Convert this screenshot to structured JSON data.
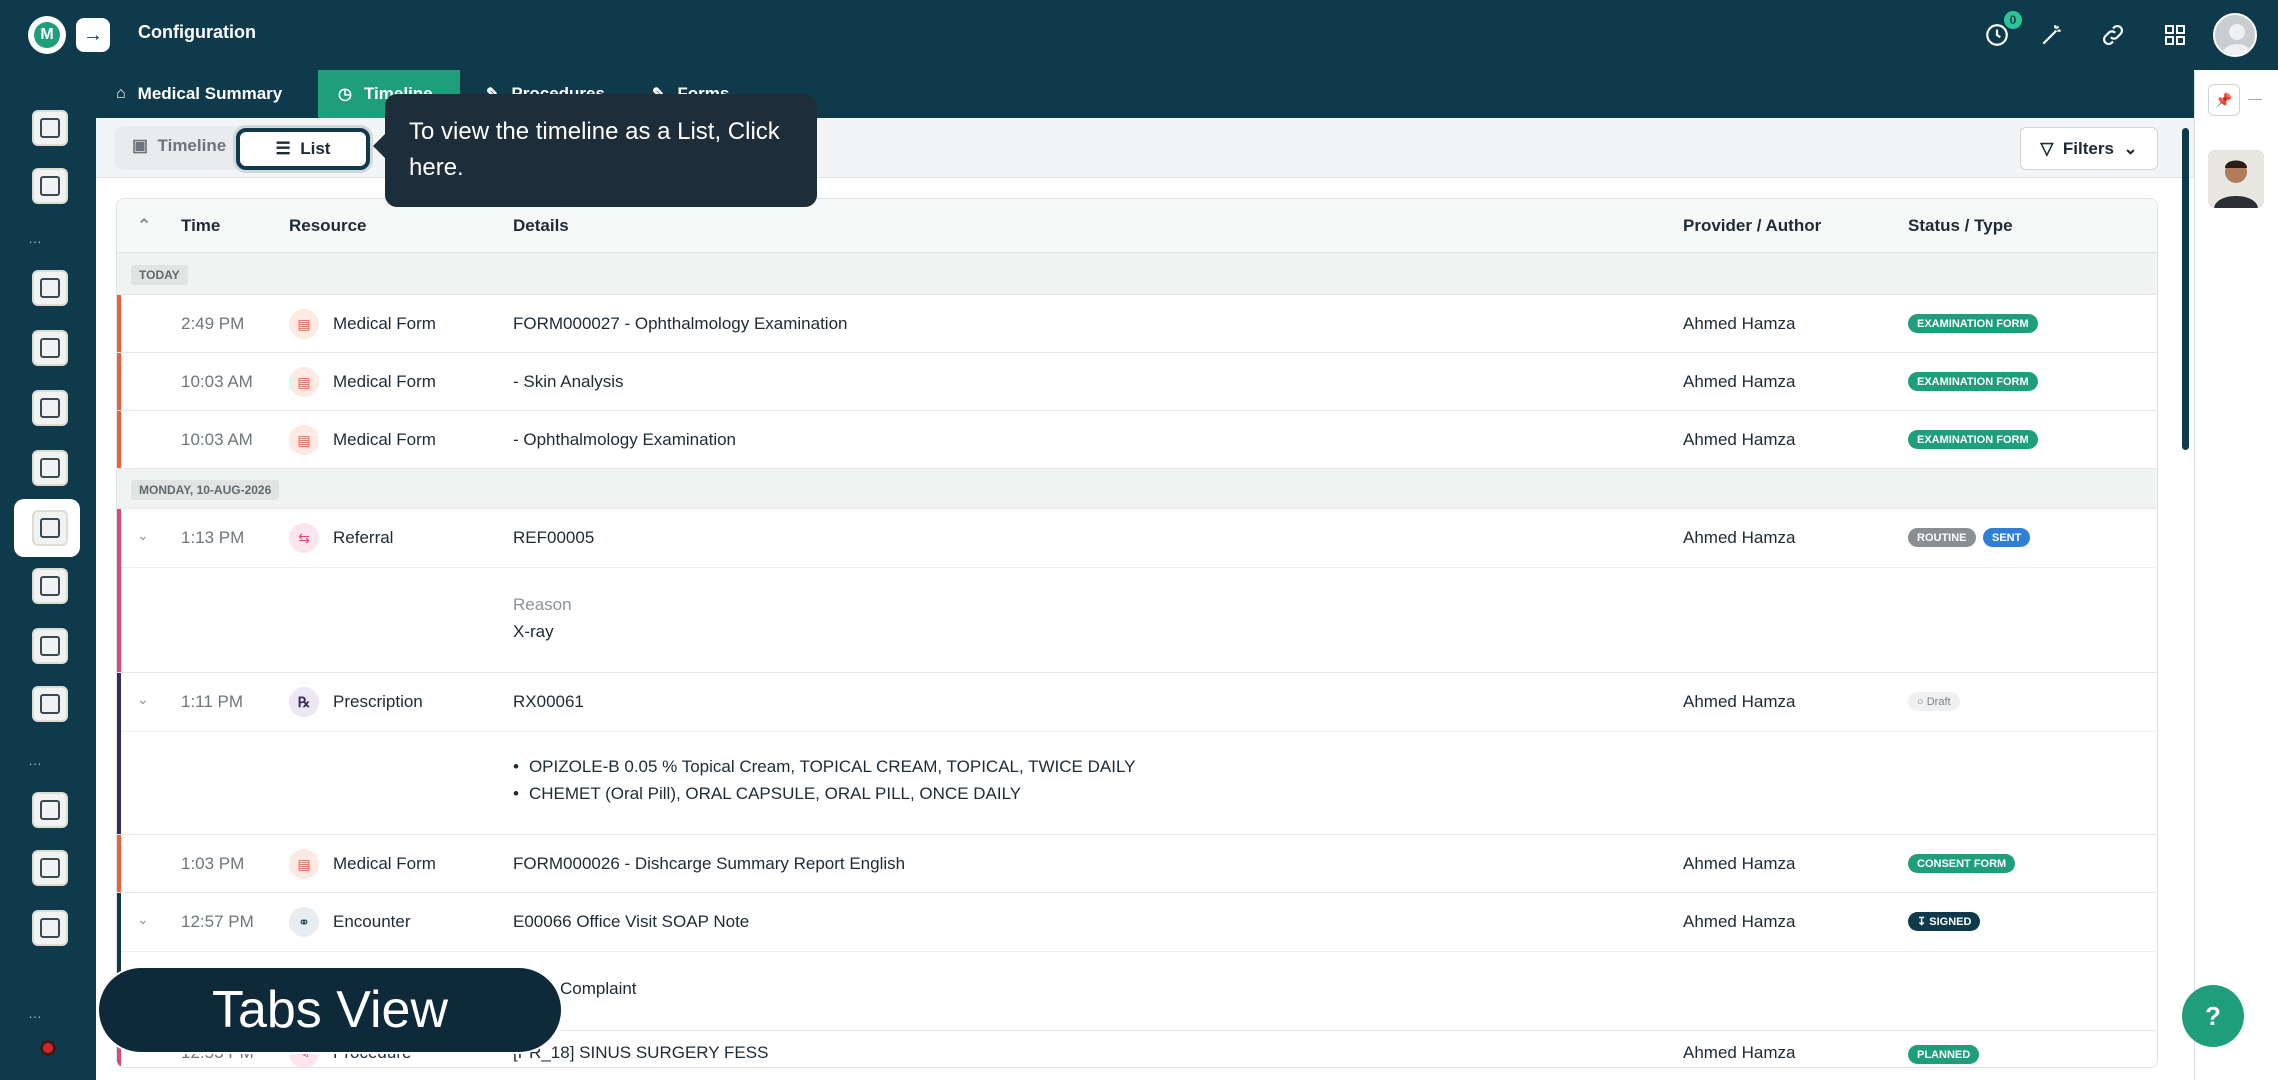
{
  "app": {
    "title": "Configuration",
    "badge_count": "0"
  },
  "tabs": [
    {
      "label": "Medical Summary",
      "icon": "home-icon"
    },
    {
      "label": "Timeline",
      "icon": "history-icon"
    },
    {
      "label": "Procedures",
      "icon": "scalpel-icon"
    },
    {
      "label": "Forms",
      "icon": "form-icon"
    }
  ],
  "view_toggle": {
    "timeline_label": "Timeline",
    "list_label": "List"
  },
  "filters_label": "Filters",
  "tooltip": {
    "text": "To view the timeline as a List, Click here."
  },
  "table": {
    "headers": {
      "time": "Time",
      "resource": "Resource",
      "details": "Details",
      "provider": "Provider / Author",
      "status": "Status / Type"
    },
    "groups": [
      {
        "label": "TODAY"
      },
      {
        "label": "MONDAY, 10-AUG-2026"
      }
    ],
    "rows": [
      {
        "time": "2:49 PM",
        "resource": "Medical Form",
        "details": "FORM000027 - Ophthalmology Examination",
        "provider": "Ahmed Hamza",
        "badges": [
          "EXAMINATION FORM"
        ]
      },
      {
        "time": "10:03 AM",
        "resource": "Medical Form",
        "details": "- Skin Analysis",
        "provider": "Ahmed Hamza",
        "badges": [
          "EXAMINATION FORM"
        ]
      },
      {
        "time": "10:03 AM",
        "resource": "Medical Form",
        "details": "- Ophthalmology Examination",
        "provider": "Ahmed Hamza",
        "badges": [
          "EXAMINATION FORM"
        ]
      },
      {
        "time": "1:13 PM",
        "resource": "Referral",
        "details": "REF00005",
        "provider": "Ahmed Hamza",
        "badges": [
          "ROUTINE",
          "SENT"
        ],
        "sub_label": "Reason",
        "sub_value": "X-ray"
      },
      {
        "time": "1:11 PM",
        "resource": "Prescription",
        "details": "RX00061",
        "provider": "Ahmed Hamza",
        "badges": [
          "Draft"
        ],
        "items": [
          "OPIZOLE-B 0.05 % Topical Cream, TOPICAL CREAM, TOPICAL, TWICE DAILY",
          "CHEMET (Oral Pill), ORAL CAPSULE, ORAL PILL, ONCE DAILY"
        ]
      },
      {
        "time": "1:03 PM",
        "resource": "Medical Form",
        "details": "FORM000026 - Dishcarge Summary Report English",
        "provider": "Ahmed Hamza",
        "badges": [
          "CONSENT FORM"
        ]
      },
      {
        "time": "12:57 PM",
        "resource": "Encounter",
        "details": "E00066 Office Visit SOAP Note",
        "provider": "Ahmed Hamza",
        "badges": [
          "SIGNED"
        ],
        "sub_value": "Complaint"
      },
      {
        "time": "12:53 PM",
        "resource": "Procedure",
        "details": "[PR_18] SINUS SURGERY FESS",
        "provider": "Ahmed Hamza",
        "badges": [
          "PLANNED"
        ]
      }
    ]
  },
  "overlay_label": "Tabs View",
  "colors": {
    "primary": "#0e3a4b",
    "accent": "#1f9e7c",
    "form_bar": "#e8643c",
    "referral_bar": "#d64b7c",
    "rx_bar": "#3a2a5a",
    "encounter_bar": "#0e3a4b"
  }
}
